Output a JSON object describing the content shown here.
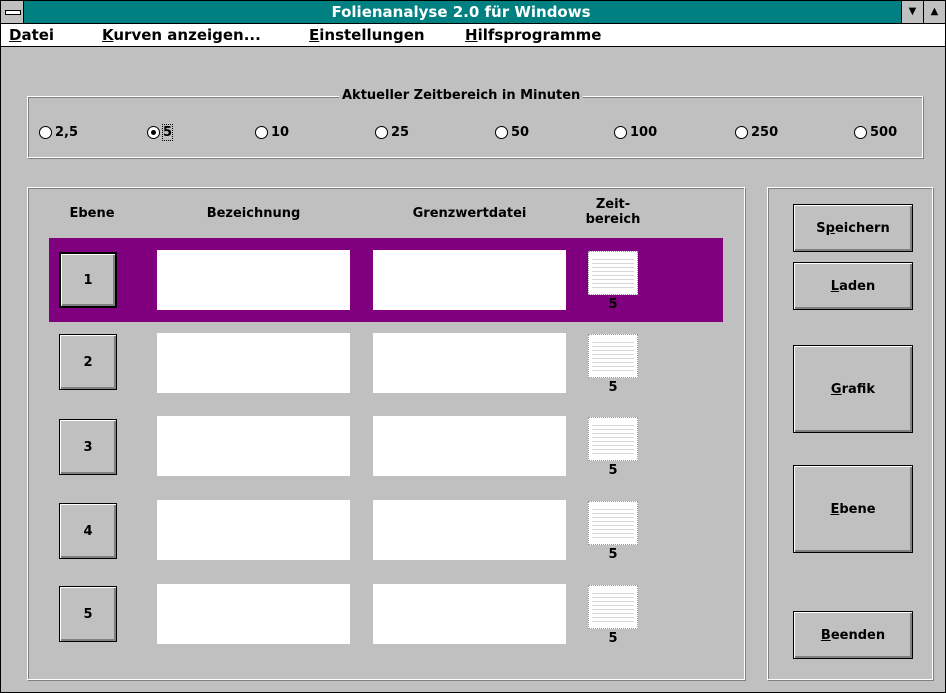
{
  "window": {
    "title": "Folienanalyse 2.0 für Windows",
    "minimize_glyph": "▼",
    "maximize_glyph": "▲"
  },
  "menu": [
    {
      "ul": "D",
      "rest": "atei"
    },
    {
      "ul": "K",
      "rest": "urven anzeigen..."
    },
    {
      "ul": "E",
      "rest": "instellungen"
    },
    {
      "ul": "H",
      "rest": "ilfsprogramme"
    }
  ],
  "timerange": {
    "title": "Aktueller Zeitbereich in Minuten",
    "options": [
      "2,5",
      "5",
      "10",
      "25",
      "50",
      "100",
      "250",
      "500"
    ],
    "selected": "5"
  },
  "table": {
    "headers": {
      "ebene": "Ebene",
      "bezeichnung": "Bezeichnung",
      "grenzwert": "Grenzwertdatei",
      "zeit_line1": "Zeit-",
      "zeit_line2": "bereich"
    },
    "rows": [
      {
        "num": "1",
        "bezeichnung": "",
        "grenzwert": "",
        "zeit": "5",
        "selected": true
      },
      {
        "num": "2",
        "bezeichnung": "",
        "grenzwert": "",
        "zeit": "5",
        "selected": false
      },
      {
        "num": "3",
        "bezeichnung": "",
        "grenzwert": "",
        "zeit": "5",
        "selected": false
      },
      {
        "num": "4",
        "bezeichnung": "",
        "grenzwert": "",
        "zeit": "5",
        "selected": false
      },
      {
        "num": "5",
        "bezeichnung": "",
        "grenzwert": "",
        "zeit": "5",
        "selected": false
      }
    ],
    "selected_row_color": "#800080"
  },
  "buttons": {
    "speichern": {
      "pre": "S",
      "ul": "p",
      "rest": "eichern"
    },
    "laden": {
      "pre": "",
      "ul": "L",
      "rest": "aden"
    },
    "grafik": {
      "pre": "",
      "ul": "G",
      "rest": "rafik"
    },
    "ebene": {
      "pre": "",
      "ul": "E",
      "rest": "bene"
    },
    "beenden": {
      "pre": "",
      "ul": "B",
      "rest": "eenden"
    }
  },
  "colors": {
    "titlebar": "#008080",
    "face": "#c0c0c0",
    "selection": "#800080"
  }
}
